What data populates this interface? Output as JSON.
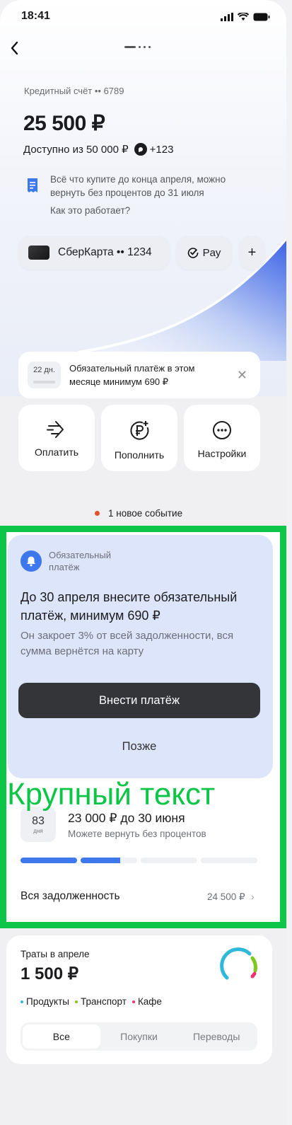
{
  "status": {
    "time": "18:41"
  },
  "account": {
    "label": "Кредитный счёт •• 6789",
    "balance": "25 500 ₽",
    "available": "Доступно из 50 000 ₽",
    "bonus": "+123",
    "info_text": "Всё что купите до конца апреля, можно вернуть без процентов до 31 июля",
    "how_link": "Как это работает?"
  },
  "cards": {
    "card_label": "СберКарта •• 1234",
    "pay_label": "Pay",
    "add_label": "+"
  },
  "notice": {
    "days": "22 дн.",
    "days_progress": 0.7,
    "text": "Обязательный платёж в этом месяце минимум 690 ₽"
  },
  "actions": [
    {
      "label": "Оплатить",
      "icon": "pay-arrow-icon"
    },
    {
      "label": "Пополнить",
      "icon": "ruble-plus-icon"
    },
    {
      "label": "Настройки",
      "icon": "more-dots-icon"
    }
  ],
  "event": {
    "text": "1 новое событие",
    "dot_color": "#e2532f"
  },
  "payment_card": {
    "category": "Обязательный платёж",
    "title": "До 30 апреля внесите обязательный платёж, минимум 690 ₽",
    "subtitle": "Он закроет 3% от всей задолженности, вся сумма вернётся на карту",
    "primary_button": "Внести платёж",
    "secondary_button": "Позже"
  },
  "overlay_label": "Крупный текст",
  "debt": {
    "days": "83",
    "days_unit": "дня",
    "title": "23 000 ₽ до 30 июня",
    "subtitle": "Можете вернуть без процентов",
    "segments_filled": 1.7,
    "segments_total": 4,
    "total_label": "Вся задолженность",
    "total_value": "24 500 ₽"
  },
  "spending": {
    "label": "Траты в апреле",
    "value": "1 500 ₽",
    "legend": [
      {
        "name": "Продукты",
        "color": "#2fb8d9"
      },
      {
        "name": "Транспорт",
        "color": "#7ec820"
      },
      {
        "name": "Кафе",
        "color": "#f2336f"
      }
    ],
    "tabs": [
      "Все",
      "Покупки",
      "Переводы"
    ],
    "active_tab": 0
  },
  "colors": {
    "accent_blue": "#3d78ee",
    "green": "#21a038",
    "highlight": "#0dc546",
    "dark_button": "#333538"
  }
}
